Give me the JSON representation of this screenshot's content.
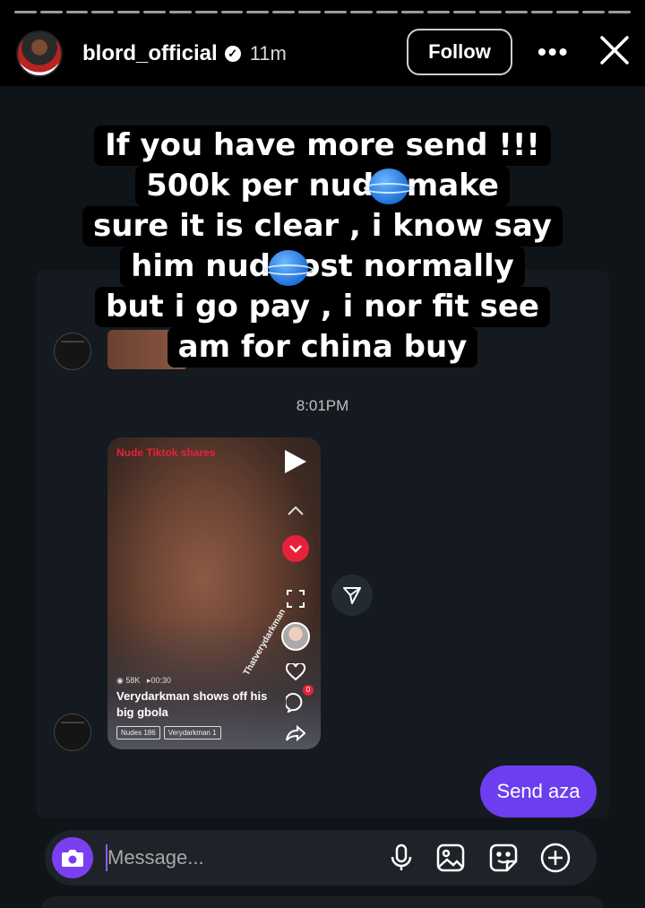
{
  "story": {
    "username": "blord_official",
    "time_ago": "11m",
    "follow_label": "Follow",
    "more_label": "•••",
    "progress_fraction": 1.0
  },
  "caption": {
    "lines": [
      "If you have more send !!!",
      "500k per nud   , make",
      "sure it is clear , i know say",
      "him nud   cost normally",
      "but i go pay , i nor fit see",
      "am for china buy"
    ]
  },
  "chat": {
    "timestamp": "8:01PM",
    "reel": {
      "tag": "Nude Tiktok shares",
      "views": "58K",
      "duration": "00:30",
      "vertical_tag": "Thatverydarkman",
      "title": "Verydarkman shows off his big gbola",
      "chips": [
        "Nudes 186",
        "Verydarkman 1"
      ],
      "comment_count": "0"
    },
    "sent_message": "Send aza"
  },
  "composer": {
    "placeholder": "Message..."
  },
  "colors": {
    "accent": "#6d3df0",
    "camera": "#7b3ff2",
    "reel_red": "#e8213a",
    "chat_bg": "#0f1419"
  }
}
